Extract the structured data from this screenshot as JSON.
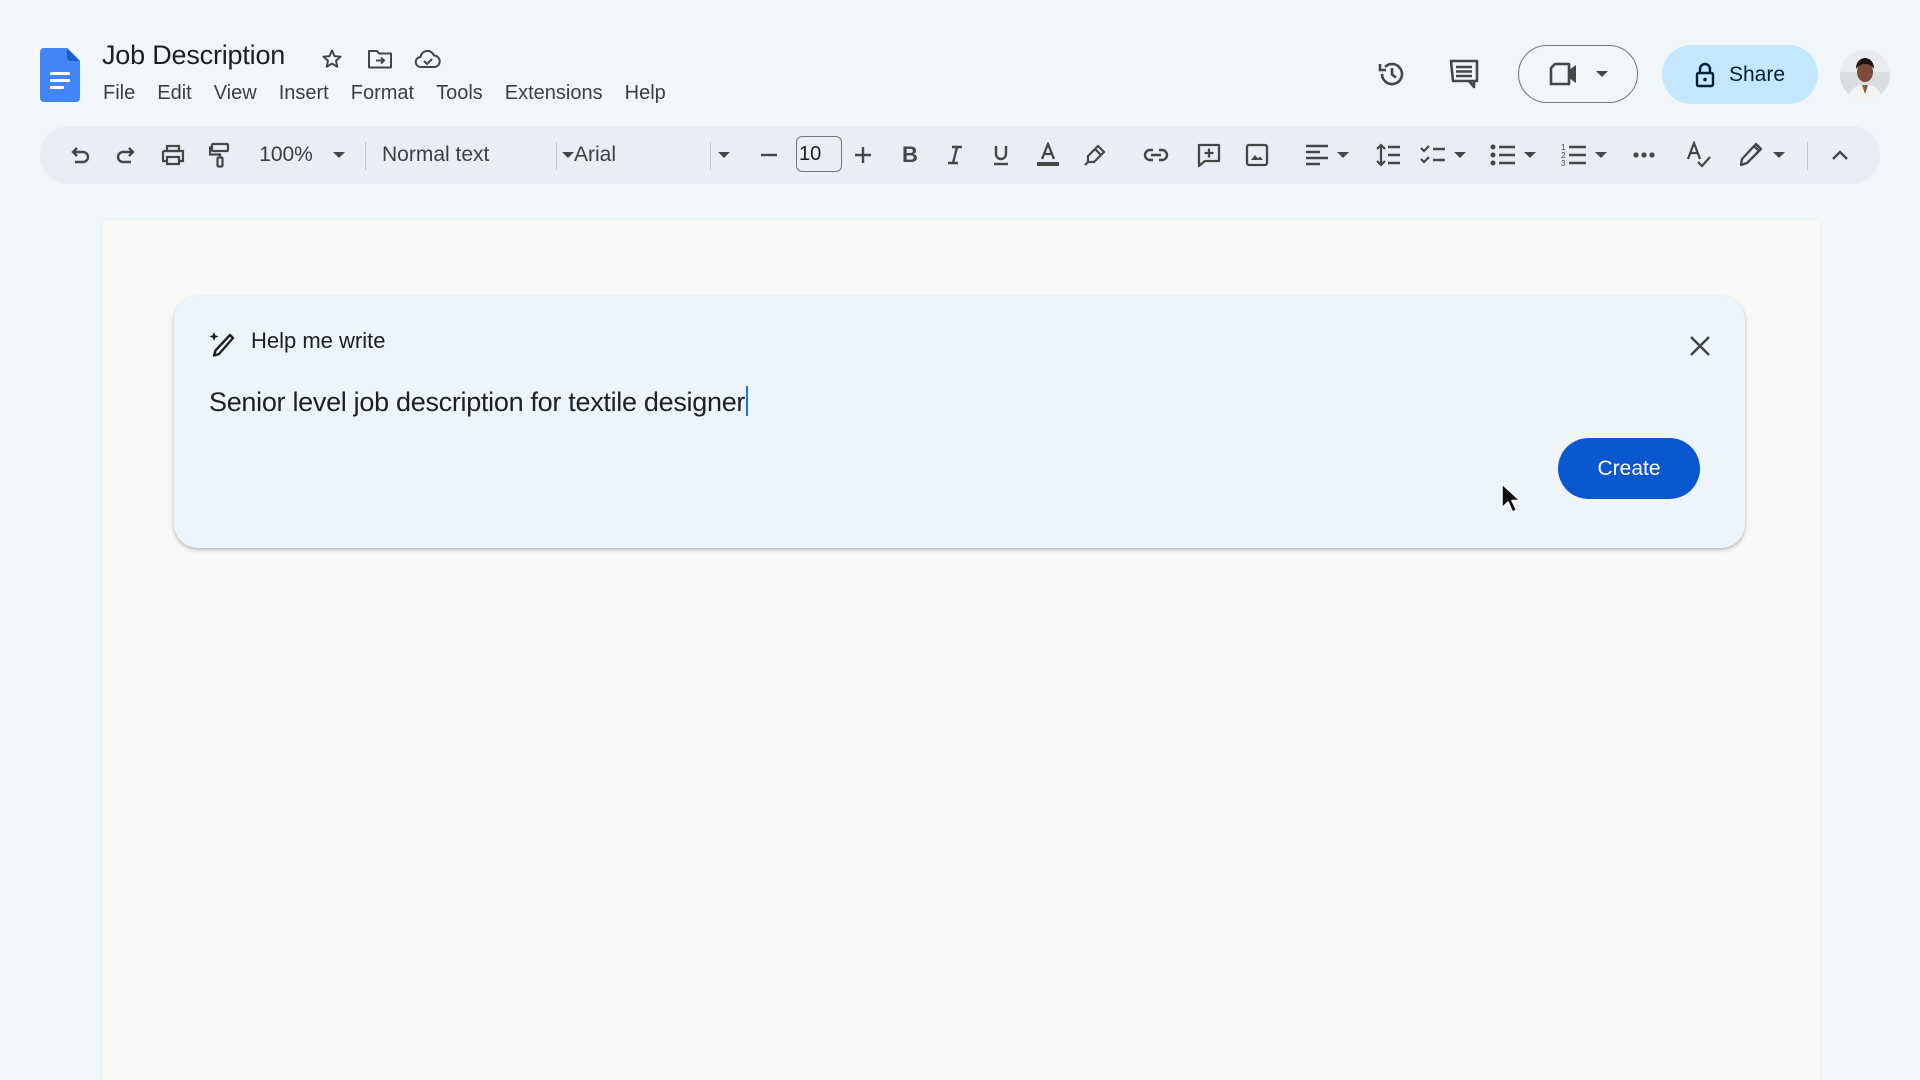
{
  "header": {
    "doc_title": "Job Description",
    "title_icons": [
      "star-icon",
      "move-to-folder-icon",
      "cloud-saved-icon"
    ],
    "menu": [
      "File",
      "Edit",
      "View",
      "Insert",
      "Format",
      "Tools",
      "Extensions",
      "Help"
    ],
    "right_icons": [
      "version-history-icon",
      "comments-icon"
    ],
    "meet_button": {
      "icon": "video-camera-icon"
    },
    "share_button": {
      "label": "Share",
      "icon": "lock-icon"
    },
    "avatar": "user-avatar"
  },
  "toolbar": {
    "zoom": "100%",
    "style": "Normal text",
    "font": "Arial",
    "font_size": "10",
    "tools": [
      "undo",
      "redo",
      "print",
      "paint-format",
      "decrease-font-size",
      "increase-font-size",
      "bold",
      "italic",
      "underline",
      "text-color",
      "highlight",
      "insert-link",
      "add-comment",
      "insert-image",
      "align",
      "line-spacing",
      "checklist",
      "bulleted-list",
      "numbered-list",
      "more",
      "spellcheck",
      "editing-mode",
      "hide-menus"
    ]
  },
  "help_me_write": {
    "title": "Help me write",
    "prompt": "Senior level job description for textile designer",
    "create_label": "Create"
  },
  "colors": {
    "app_bg": "#f1f6f8",
    "toolbar_bg": "#e9eef4",
    "share_bg": "#c2e7ff",
    "create_bg": "#0b57d0",
    "docs_blue": "#4285f4",
    "dialog_bg": "#eef5fa"
  }
}
